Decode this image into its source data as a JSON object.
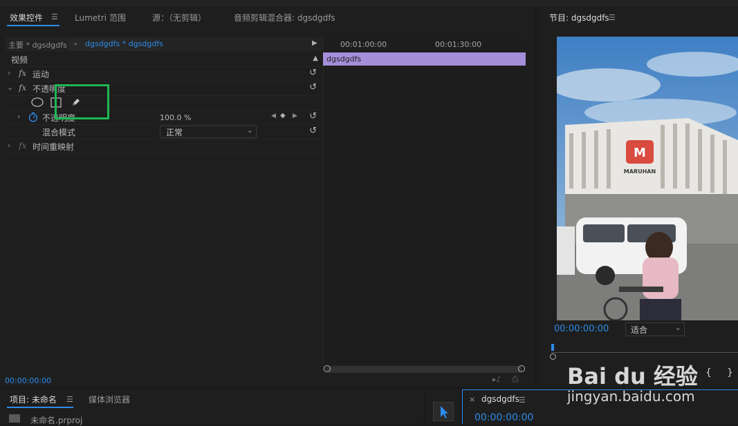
{
  "tabs": {
    "effect_controls": "效果控件",
    "lumetri_scopes": "Lumetri 范围",
    "source": "源：（无剪辑）",
    "audio_mixer": "音频剪辑混合器: dgsdgdfs"
  },
  "effect_controls": {
    "master_label": "主要 * dgsdgdfs",
    "sequence_label": "dgsdgdfs * dgsdgdfs",
    "section_video": "视频",
    "motion": "运动",
    "opacity_group": "不透明度",
    "opacity_param": "不透明度",
    "opacity_value": "100.0 %",
    "blend_mode_label": "混合模式",
    "blend_mode_value": "正常",
    "time_remap": "时间重映射",
    "timecode": "00:00:00:00",
    "fx_glyph": "fx"
  },
  "mini_timeline": {
    "ruler": [
      "00:01:00:00",
      "00:01:30:00"
    ],
    "clip_name": "dgsdgdfs",
    "clip_color": "#a58fdb"
  },
  "program": {
    "title": "节目: dgsdgdfs",
    "timecode": "00:00:00:00",
    "fit_label": "适合",
    "store_sign": "MARUHAN"
  },
  "project": {
    "title": "项目: 未命名",
    "media_browser": "媒体浏览器",
    "file_name": "未命名.prproj"
  },
  "timeline": {
    "close_glyph": "×",
    "sequence_tab": "dgsdgdfs",
    "timecode": "00:00:00:00"
  },
  "watermark": {
    "logo": "Bai du 经验",
    "url": "jingyan.baidu.com"
  },
  "colors": {
    "accent": "#2d8ceb",
    "highlight_box": "#1db954",
    "clip": "#a58fdb"
  }
}
